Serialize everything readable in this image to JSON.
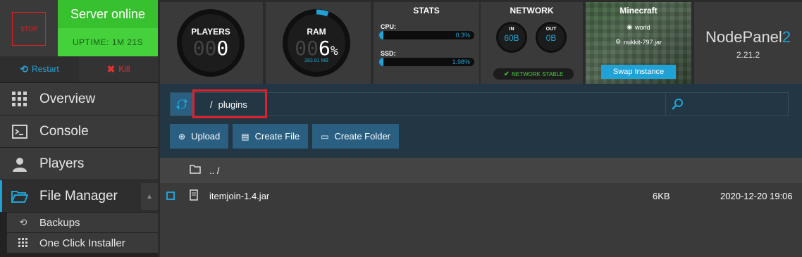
{
  "server": {
    "stop_label": "STOP",
    "status": "Server online",
    "uptime": "UPTIME: 1M 21S",
    "restart_label": "Restart",
    "kill_label": "Kill"
  },
  "nav": {
    "overview": "Overview",
    "console": "Console",
    "players": "Players",
    "file_manager": "File Manager",
    "backups": "Backups",
    "one_click": "One Click Installer"
  },
  "players_widget": {
    "label": "PLAYERS",
    "ghost": "00",
    "value": "0"
  },
  "ram_widget": {
    "label": "RAM",
    "ghost": "00",
    "value": "6",
    "unit": "%",
    "sub": "283.91 MB",
    "percent": 6
  },
  "stats": {
    "title": "STATS",
    "cpu_label": "CPU:",
    "cpu_value": "0.3%",
    "cpu_percent": 0.3,
    "ssd_label": "SSD:",
    "ssd_value": "1.98%",
    "ssd_percent": 1.98
  },
  "network": {
    "title": "NETWORK",
    "in_label": "IN",
    "in_value": "60B",
    "out_label": "OUT",
    "out_value": "0B",
    "stable_text": "NETWORK STABLE"
  },
  "minecraft": {
    "title": "Minecraft",
    "world": "world",
    "jar": "nukkit-797.jar",
    "swap_label": "Swap Instance"
  },
  "brand": {
    "name": "NodePanel",
    "name_suffix": "2",
    "version": "2.21.2"
  },
  "file_manager": {
    "path_sep": "/",
    "path": "plugins",
    "upload_label": "Upload",
    "create_file_label": "Create File",
    "create_folder_label": "Create Folder",
    "parent_label": ".. /",
    "files": [
      {
        "name": "itemjoin-1.4.jar",
        "size": "6KB",
        "date": "2020-12-20 19:06"
      }
    ]
  },
  "colors": {
    "accent": "#1fa3d6",
    "online_green": "#38c12e",
    "kill_red": "#e03131",
    "highlight_red": "#e0202a"
  }
}
